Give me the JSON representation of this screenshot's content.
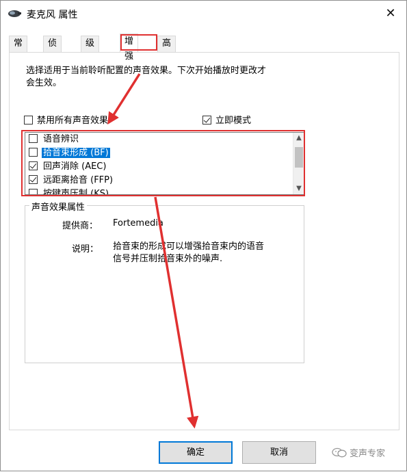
{
  "window": {
    "title": "麦克风 属性",
    "close_glyph": "✕"
  },
  "tabs": [
    {
      "label": "常规"
    },
    {
      "label": "侦听"
    },
    {
      "label": "级别"
    },
    {
      "label": "增强"
    },
    {
      "label": "高级"
    }
  ],
  "active_tab": "增强",
  "panel": {
    "description_line1": "选择适用于当前聆听配置的声音效果。下次开始播放时更改才",
    "description_line2": "会生效。",
    "disable_all": {
      "label": "禁用所有声音效果",
      "checked": false
    },
    "immediate_mode": {
      "label": "立即模式",
      "checked": true
    },
    "effects": [
      {
        "label": "语音辨识",
        "checked": false
      },
      {
        "label": "拾音束形成 (BF)",
        "checked": false,
        "selected": true
      },
      {
        "label": "回声消除 (AEC)",
        "checked": true
      },
      {
        "label": "远距离拾音 (FFP)",
        "checked": true
      },
      {
        "label": "按键声压制 (KS)",
        "checked": false
      }
    ],
    "properties": {
      "group_title": "声音效果属性",
      "provider_label": "提供商：",
      "provider_value": "Fortemedia",
      "description_label": "说明：",
      "description_line1": "拾音束的形成可以增强拾音束内的语音",
      "description_line2": "信号并压制拾音束外的噪声."
    }
  },
  "buttons": {
    "ok": "确定",
    "cancel": "取消"
  },
  "watermark": {
    "text": "变声专家"
  },
  "colors": {
    "highlight_red": "#e03030",
    "selection_blue": "#0078d7"
  },
  "icons": {
    "app": "microphone-icon",
    "close": "close-icon",
    "scroll_up": "chevron-up-icon",
    "scroll_down": "chevron-down-icon"
  }
}
